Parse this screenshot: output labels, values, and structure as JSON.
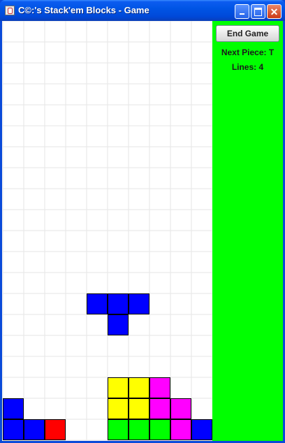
{
  "window": {
    "title": "C©:'s Stack'em Blocks - Game",
    "minimize_label": "",
    "maximize_label": "",
    "close_label": "✕"
  },
  "side_panel": {
    "end_game_label": "End Game",
    "next_piece_text": "Next Piece: T",
    "lines_text": "Lines: 4"
  },
  "colors": {
    "side_panel": "#00ff00",
    "grid_line": "#e6e6e6",
    "blue": "#0000ff",
    "red": "#ff0000",
    "yellow": "#ffff00",
    "magenta": "#ff00ff",
    "green": "#00ff00"
  },
  "board": {
    "columns": 10,
    "rows": 20,
    "falling_piece": {
      "shape": "T",
      "color": "blue",
      "cells": [
        [
          4,
          13
        ],
        [
          5,
          13
        ],
        [
          6,
          13
        ],
        [
          5,
          14
        ]
      ]
    },
    "locked_cells": [
      {
        "col": 5,
        "row": 17,
        "color": "yellow"
      },
      {
        "col": 6,
        "row": 17,
        "color": "yellow"
      },
      {
        "col": 7,
        "row": 17,
        "color": "magenta"
      },
      {
        "col": 0,
        "row": 18,
        "color": "blue"
      },
      {
        "col": 5,
        "row": 18,
        "color": "yellow"
      },
      {
        "col": 6,
        "row": 18,
        "color": "yellow"
      },
      {
        "col": 7,
        "row": 18,
        "color": "magenta"
      },
      {
        "col": 8,
        "row": 18,
        "color": "magenta"
      },
      {
        "col": 0,
        "row": 19,
        "color": "blue"
      },
      {
        "col": 1,
        "row": 19,
        "color": "blue"
      },
      {
        "col": 2,
        "row": 19,
        "color": "red"
      },
      {
        "col": 5,
        "row": 19,
        "color": "green"
      },
      {
        "col": 6,
        "row": 19,
        "color": "green"
      },
      {
        "col": 7,
        "row": 19,
        "color": "green"
      },
      {
        "col": 8,
        "row": 19,
        "color": "magenta"
      },
      {
        "col": 9,
        "row": 19,
        "color": "blue"
      }
    ]
  }
}
